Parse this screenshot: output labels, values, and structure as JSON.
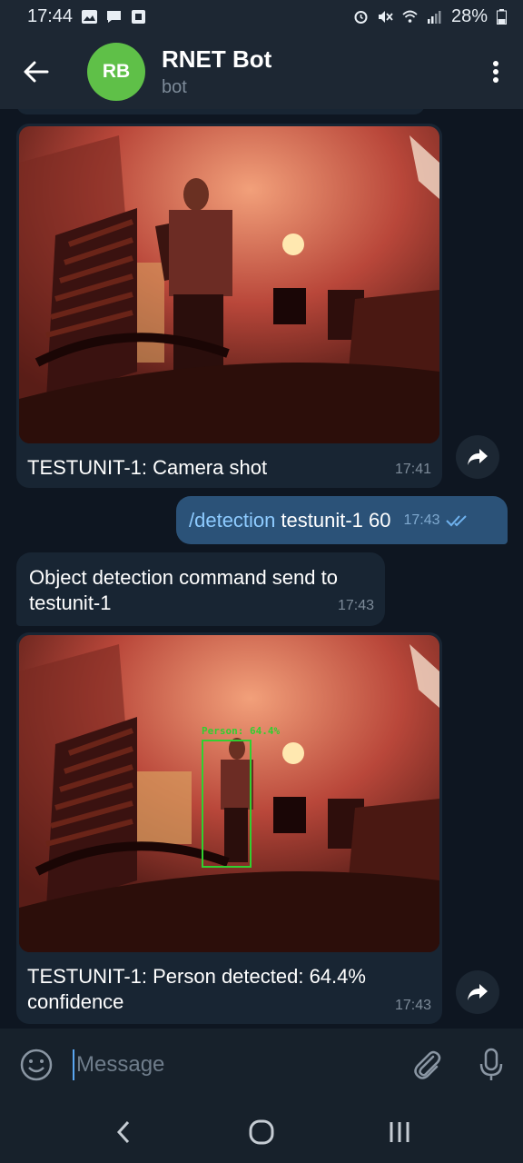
{
  "status_bar": {
    "time": "17:44",
    "battery": "28%",
    "icons_left": [
      "image-icon",
      "chat-icon",
      "square-icon"
    ],
    "icons_right": [
      "alarm-icon",
      "mute-icon",
      "wifi-icon",
      "signal-icon",
      "battery-icon"
    ]
  },
  "header": {
    "avatar_initials": "RB",
    "title": "RNET Bot",
    "subtitle": "bot",
    "avatar_color": "#5fc048"
  },
  "messages": [
    {
      "type": "photo",
      "direction": "incoming",
      "caption": "TESTUNIT-1: Camera shot",
      "time": "17:41"
    },
    {
      "type": "text",
      "direction": "outgoing",
      "command": "/detection",
      "text": "testunit-1 60",
      "time": "17:43",
      "status": "read"
    },
    {
      "type": "text",
      "direction": "incoming",
      "text": "Object detection command send to testunit-1",
      "time": "17:43"
    },
    {
      "type": "photo",
      "direction": "incoming",
      "caption": "TESTUNIT-1: Person detected: 64.4% confidence",
      "time": "17:43",
      "detection_label": "Person: 64.4%"
    }
  ],
  "input": {
    "placeholder": "Message"
  },
  "colors": {
    "background": "#0e1621",
    "incoming_bubble": "#182533",
    "outgoing_bubble": "#2b5278",
    "accent": "#5aa6f0"
  }
}
